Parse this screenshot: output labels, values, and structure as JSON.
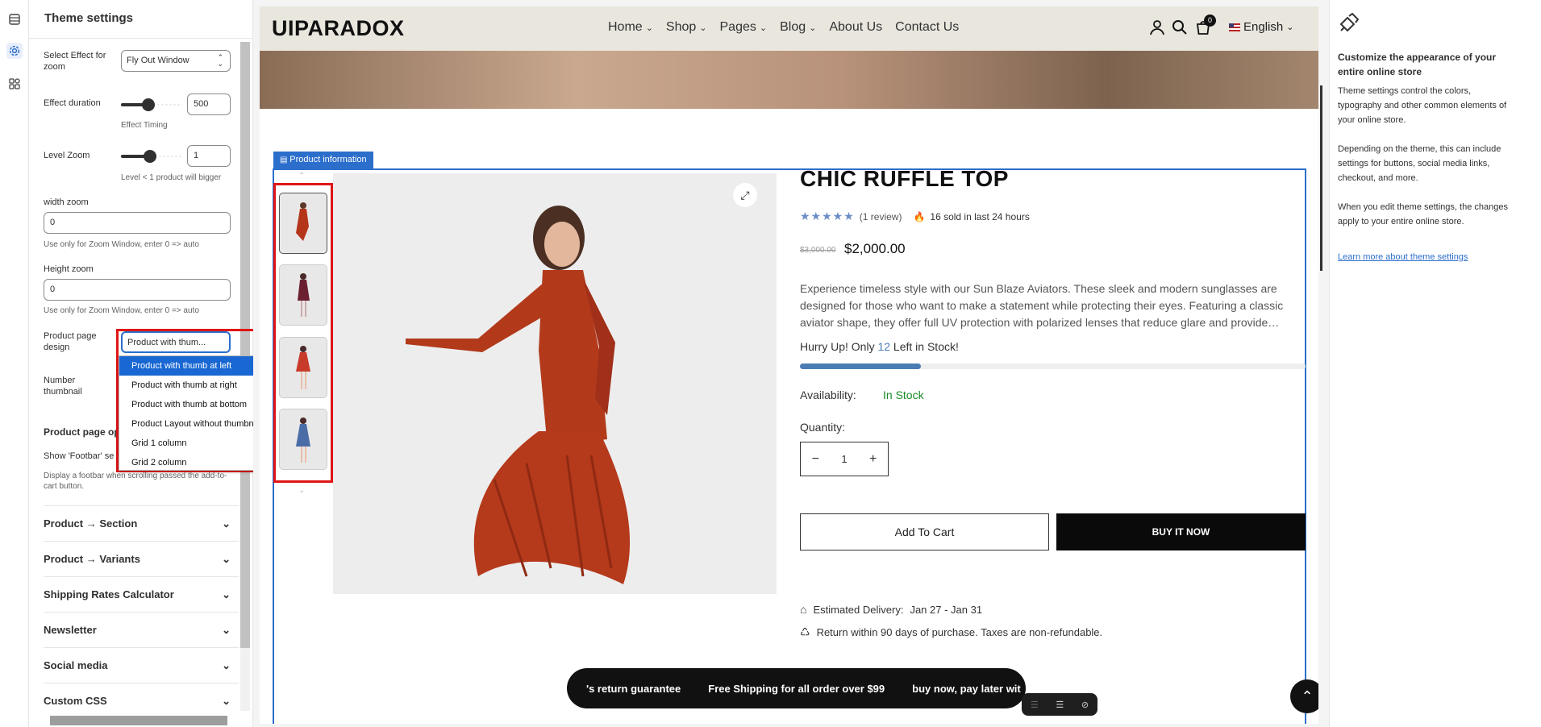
{
  "left_panel": {
    "title": "Theme settings",
    "zoom_effect_label": "Select Effect for zoom",
    "zoom_effect_value": "Fly Out Window",
    "effect_duration_label": "Effect duration",
    "effect_duration_value": "500",
    "effect_timing_hint": "Effect Timing",
    "level_zoom_label": "Level Zoom",
    "level_zoom_value": "1",
    "level_zoom_hint": "Level < 1 product will bigger",
    "width_zoom_label": "width zoom",
    "width_zoom_value": "0",
    "width_zoom_hint": "Use only for Zoom Window, enter 0 => auto",
    "height_zoom_label": "Height zoom",
    "height_zoom_value": "0",
    "height_zoom_hint": "Use only for Zoom Window, enter 0 => auto",
    "page_design_label": "Product page design",
    "page_design_value": "Product with thum...",
    "number_thumbnail_label": "Number thumbnail",
    "product_page_options_label": "Product page op",
    "show_footbar_label": "Show 'Footbar' se",
    "footbar_hint": "Display a footbar when scrolling passed the add-to-cart button.",
    "dropdown_options": [
      "Product with thumb at left",
      "Product with thumb at right",
      "Product with thumb at bottom",
      "Product Layout without thumbnail",
      "Grid 1 column",
      "Grid 2 column"
    ],
    "sections": [
      "Product → Section",
      "Product → Variants",
      "Shipping Rates Calculator",
      "Newsletter",
      "Social media",
      "Custom CSS"
    ]
  },
  "store": {
    "logo": "UIPARADOX",
    "nav": [
      "Home",
      "Shop",
      "Pages",
      "Blog",
      "About Us",
      "Contact Us"
    ],
    "cart_count": "0",
    "language": "English",
    "badge": "Product information",
    "product": {
      "title": "CHIC RUFFLE TOP",
      "review_text": "(1 review)",
      "sold_text": "16 sold in last 24 hours",
      "old_price": "$3,000.00",
      "price": "$2,000.00",
      "description": "Experience timeless style with our Sun Blaze Aviators. These sleek and modern sunglasses are designed for those who want to make a statement while protecting their eyes. Featuring a classic aviator shape, they offer full UV protection with polarized lenses that reduce glare and provide…",
      "stock_prefix": "Hurry Up! Only ",
      "stock_count": "12",
      "stock_suffix": " Left in Stock!",
      "stock_fraction": 0.24,
      "availability_label": "Availability:",
      "availability_value": "In Stock",
      "quantity_label": "Quantity:",
      "quantity_value": "1",
      "add_to_cart": "Add To Cart",
      "buy_now": "BUY IT NOW",
      "delivery_label": "Estimated Delivery:",
      "delivery_dates": "Jan 27 - Jan 31",
      "return_text": "Return within 90 days of purchase. Taxes are non-refundable."
    },
    "marquee": [
      "'s return guarantee",
      "Free Shipping for all order over $99",
      "buy now, pay later wit"
    ],
    "colors": {
      "accent": "#2c6ecb",
      "in_stock": "#1a8a2a",
      "stock_bar": "#4a7db3"
    }
  },
  "right_panel": {
    "heading": "Customize the appearance of your entire online store",
    "p1": "Theme settings control the colors, typography and other common elements of your online store.",
    "p2": "Depending on the theme, this can include settings for buttons, social media links, checkout, and more.",
    "p3": "When you edit theme settings, the changes apply to your entire online store.",
    "link": "Learn more about theme settings"
  }
}
